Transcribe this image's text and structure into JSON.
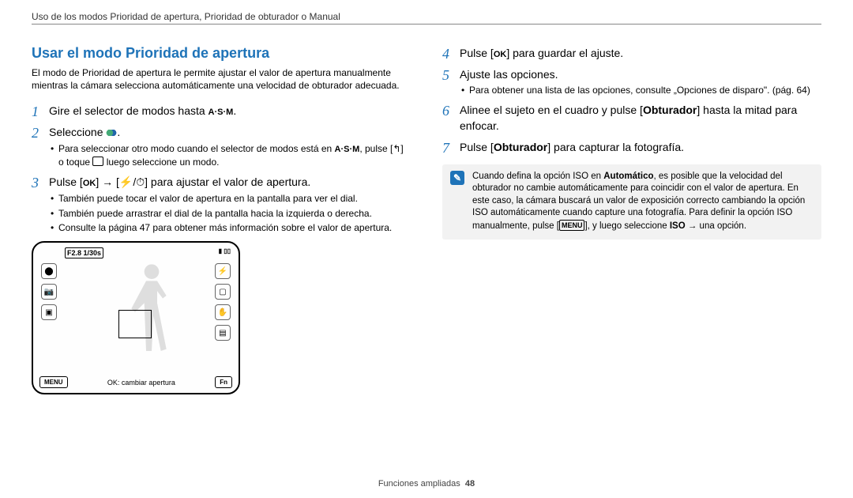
{
  "header": "Uso de los modos Prioridad de apertura, Prioridad de obturador o Manual",
  "left": {
    "title": "Usar el modo Prioridad de apertura",
    "intro": "El modo de Prioridad de apertura le permite ajustar el valor de apertura manualmente mientras la cámara selecciona automáticamente una velocidad de obturador adecuada.",
    "step1_a": "Gire el selector de modos hasta ",
    "step1_b": ".",
    "step2_a": "Seleccione ",
    "step2_b": ".",
    "step2_sub1_a": "Para seleccionar otro modo cuando el selector de modos está en ",
    "step2_sub1_b": ", pulse [",
    "step2_sub1_c": "] o toque ",
    "step2_sub1_d": " luego seleccione un modo.",
    "step3_a": "Pulse [",
    "step3_b": "] → [",
    "step3_c": "/",
    "step3_d": "] para ajustar el valor de apertura.",
    "step3_sub1": "También puede tocar el valor de apertura en la pantalla para ver el dial.",
    "step3_sub2": "También puede arrastrar el dial de la pantalla hacia la izquierda o derecha.",
    "step3_sub3": "Consulte la página 47 para obtener más información sobre el valor de apertura.",
    "glyph_asm": "A·S·M",
    "glyph_ok": "OK",
    "glyph_menu": "MENU",
    "shot": {
      "top": "F2.8 1/30s",
      "right_batt": "▥ ▦",
      "menu": "MENU",
      "center": "OK: cambiar apertura",
      "fn": "Fn"
    }
  },
  "right": {
    "step4_a": "Pulse [",
    "step4_b": "] para guardar el ajuste.",
    "step5": "Ajuste las opciones.",
    "step5_sub1": "Para obtener una lista de las opciones, consulte „Opciones de disparo\". (pág. 64)",
    "step6_a": "Alinee el sujeto en el cuadro y pulse [",
    "step6_b": "Obturador",
    "step6_c": "] hasta la mitad para enfocar.",
    "step7_a": "Pulse [",
    "step7_b": "Obturador",
    "step7_c": "] para capturar la fotografía.",
    "note_a": "Cuando defina la opción ISO en ",
    "note_b": "Automático",
    "note_c": ", es posible que la velocidad del obturador no cambie automáticamente para coincidir con el valor de apertura. En este caso, la cámara buscará un valor de exposición correcto cambiando la opción ISO automáticamente cuando capture una fotografía. Para definir la opción ISO manualmente, pulse [",
    "note_d": "], y luego seleccione ",
    "note_e": "ISO",
    "note_f": " → una opción."
  },
  "footer": {
    "label": "Funciones ampliadas",
    "page": "48"
  }
}
